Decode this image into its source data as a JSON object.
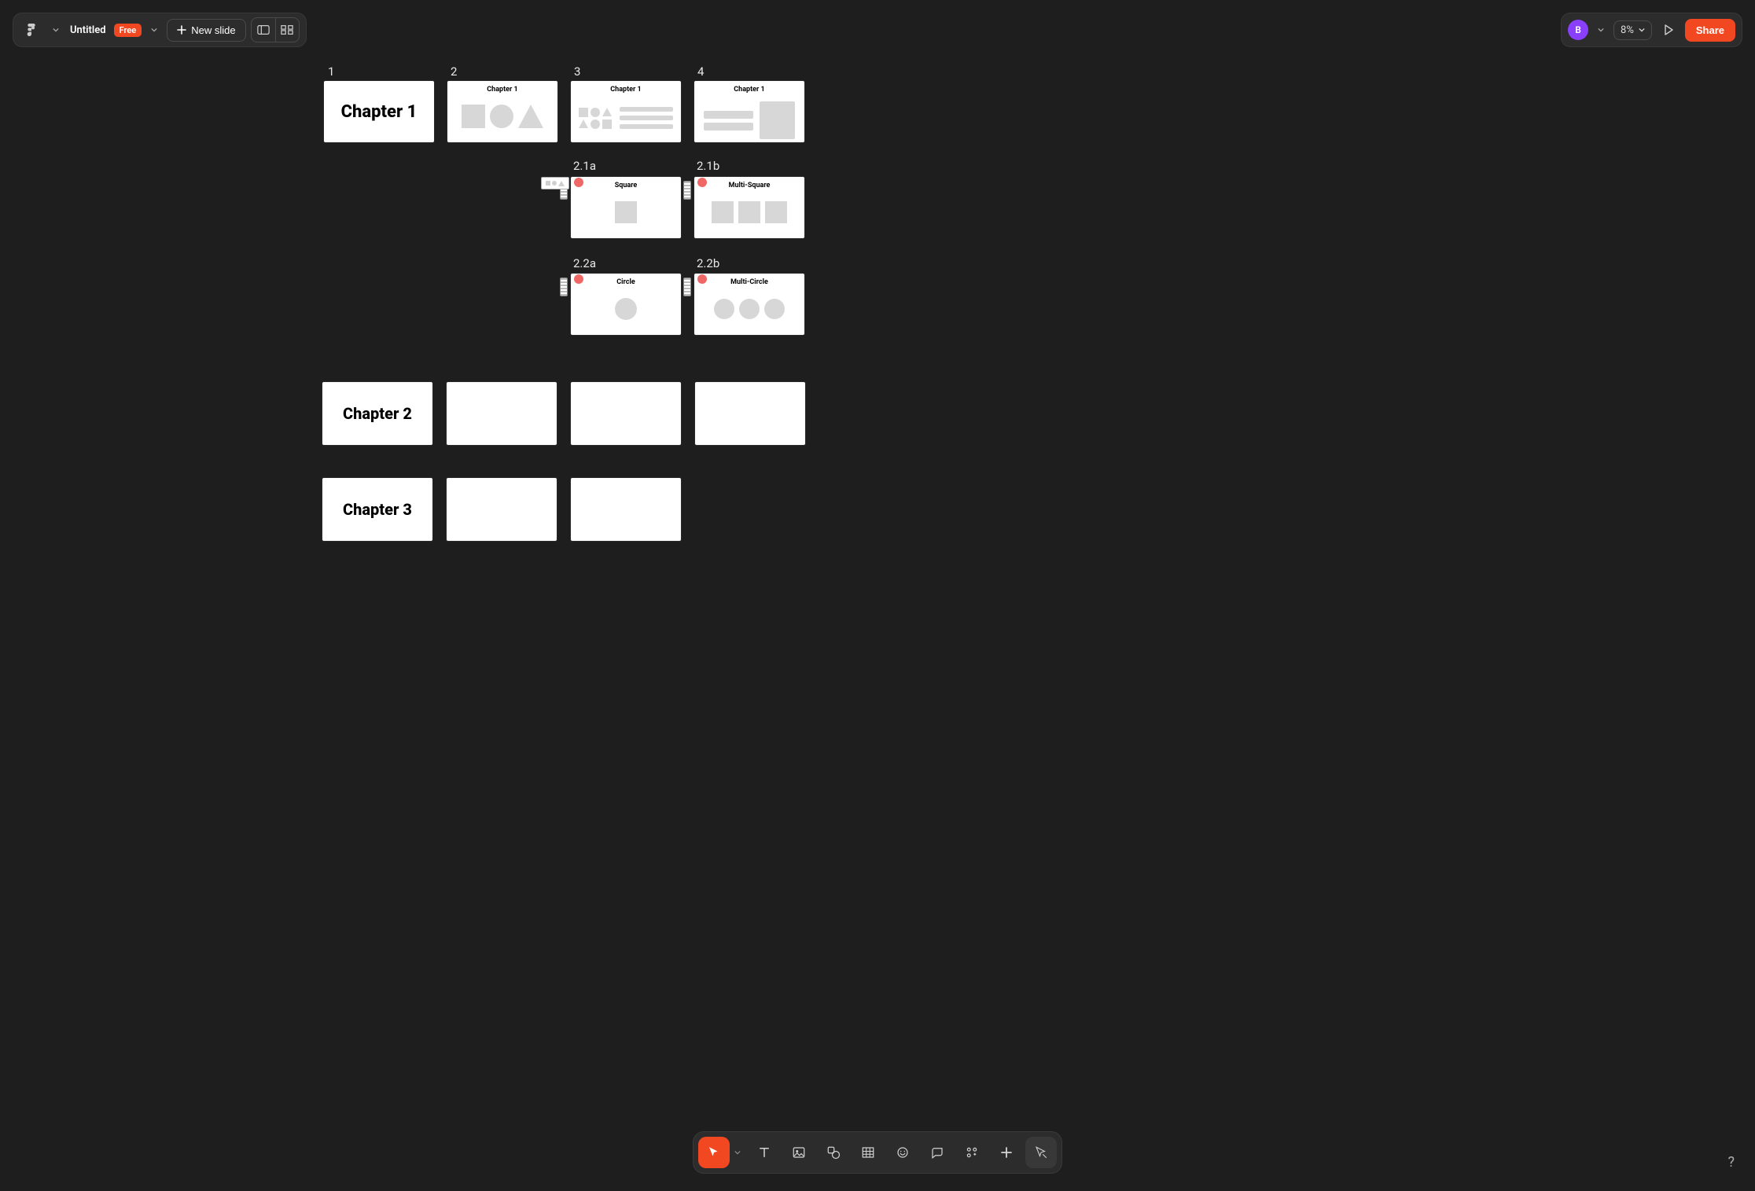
{
  "header": {
    "file_title": "Untitled",
    "badge": "Free",
    "new_slide": "New slide",
    "avatar_initial": "B",
    "zoom": "8%",
    "share": "Share"
  },
  "slides": {
    "s1": {
      "label": "1",
      "title": "Chapter 1"
    },
    "s2": {
      "label": "2",
      "subtitle": "Chapter 1"
    },
    "s3": {
      "label": "3",
      "subtitle": "Chapter 1"
    },
    "s4": {
      "label": "4",
      "subtitle": "Chapter 1"
    },
    "s21a": {
      "label": "2.1a",
      "subtitle": "Square"
    },
    "s21b": {
      "label": "2.1b",
      "subtitle": "Multi-Square"
    },
    "s22a": {
      "label": "2.2a",
      "subtitle": "Circle"
    },
    "s22b": {
      "label": "2.2b",
      "subtitle": "Multi-Circle"
    },
    "c2": {
      "title": "Chapter 2"
    },
    "c3": {
      "title": "Chapter 3"
    }
  },
  "tools": {
    "move": "Move",
    "text": "Text",
    "image": "Image",
    "shape": "Shape",
    "table": "Table",
    "widget": "Widget",
    "comment": "Comment",
    "component": "Component",
    "add": "Add",
    "handoff": "Handoff"
  },
  "help": "?",
  "colors": {
    "accent": "#f24822",
    "link": "#2aa7ff",
    "skip": "#f06866",
    "avatar": "#8a3ffc"
  }
}
